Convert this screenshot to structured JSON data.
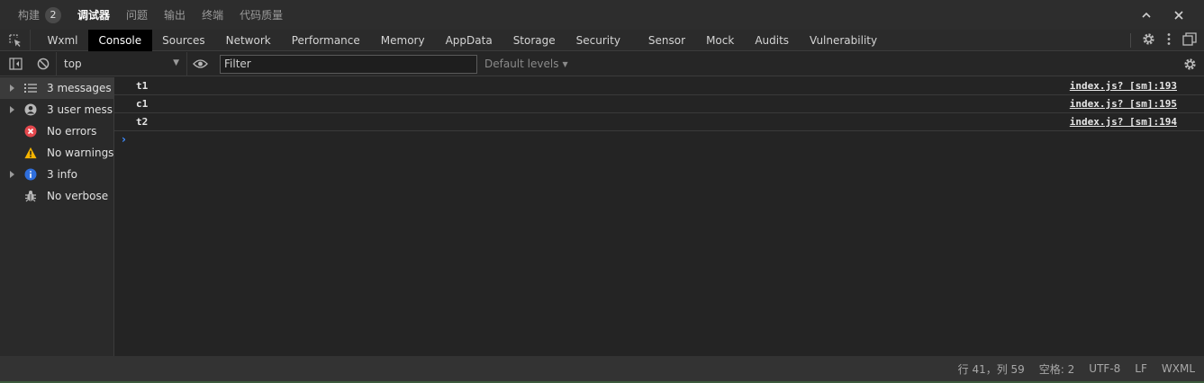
{
  "panel_tabs": {
    "build": "构建",
    "build_badge": "2",
    "debugger": "调试器",
    "problems": "问题",
    "output": "输出",
    "terminal": "终端",
    "code_quality": "代码质量"
  },
  "devtools_tabs": [
    "Wxml",
    "Console",
    "Sources",
    "Network",
    "Performance",
    "Memory",
    "AppData",
    "Storage",
    "Security",
    "Sensor",
    "Mock",
    "Audits",
    "Vulnerability"
  ],
  "active_devtools_tab": "Console",
  "console_toolbar": {
    "context": "top",
    "filter_placeholder": "Filter",
    "levels": "Default levels"
  },
  "sidebar": {
    "items": [
      {
        "label": "3 messages",
        "icon": "list-icon"
      },
      {
        "label": "3 user mess...",
        "icon": "user-icon"
      },
      {
        "label": "No errors",
        "icon": "error-icon"
      },
      {
        "label": "No warnings",
        "icon": "warning-icon"
      },
      {
        "label": "3 info",
        "icon": "info-icon"
      },
      {
        "label": "No verbose",
        "icon": "bug-icon"
      }
    ]
  },
  "messages": [
    {
      "text": "t1",
      "source": "index.js? [sm]:193"
    },
    {
      "text": "c1",
      "source": "index.js? [sm]:195"
    },
    {
      "text": "t2",
      "source": "index.js? [sm]:194"
    }
  ],
  "prompt": "›",
  "status_bar": {
    "position": "行 41，列 59",
    "spaces": "空格: 2",
    "encoding": "UTF-8",
    "eol": "LF",
    "language": "WXML"
  },
  "colors": {
    "error": "#e5484d",
    "warning": "#f5b400",
    "info": "#2f6fdd",
    "prompt": "#3f8cff"
  }
}
